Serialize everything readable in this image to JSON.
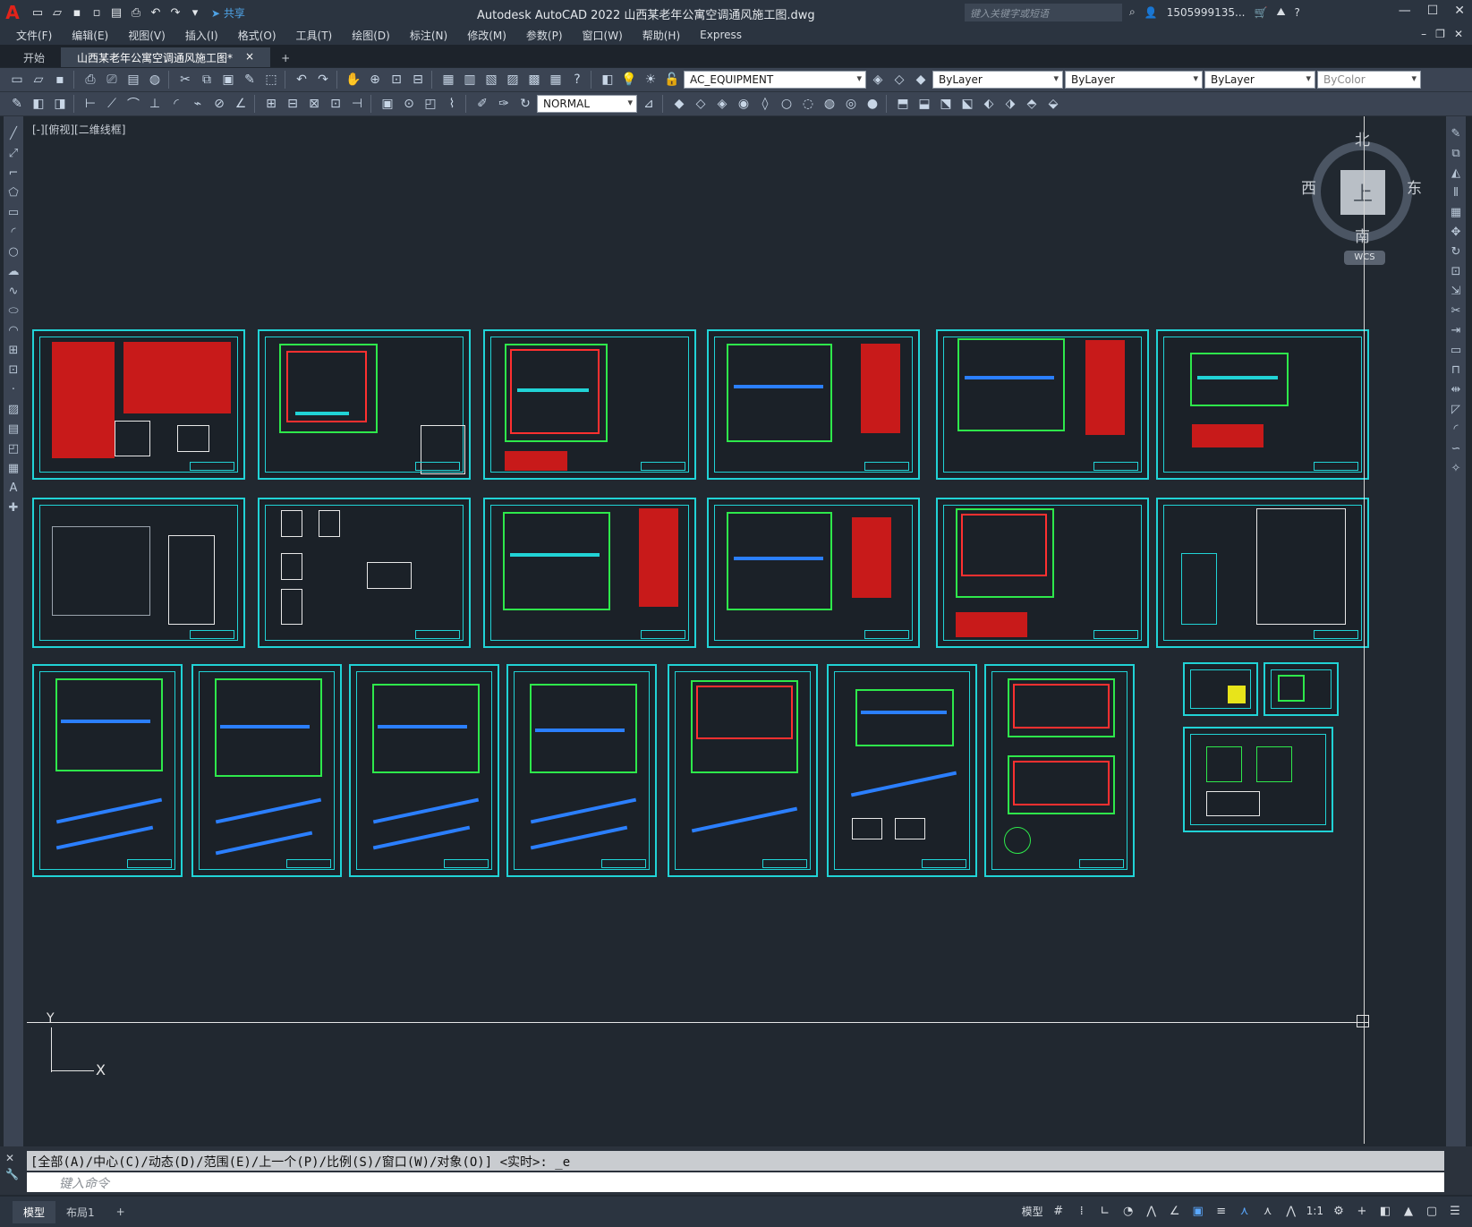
{
  "titlebar": {
    "app_logo": "A",
    "share_label": "共享",
    "title": "Autodesk AutoCAD 2022    山西某老年公寓空调通风施工图.dwg",
    "search_placeholder": "键入关键字或短语",
    "user": "1505999135..."
  },
  "menu": [
    "文件(F)",
    "编辑(E)",
    "视图(V)",
    "插入(I)",
    "格式(O)",
    "工具(T)",
    "绘图(D)",
    "标注(N)",
    "修改(M)",
    "参数(P)",
    "窗口(W)",
    "帮助(H)",
    "Express"
  ],
  "tabs": {
    "start": "开始",
    "active": "山西某老年公寓空调通风施工图*",
    "close": "×",
    "add": "+"
  },
  "toolbar1": {
    "layer": "AC_EQUIPMENT",
    "color": "ByLayer",
    "linetype": "ByLayer",
    "lineweight": "ByLayer",
    "plotstyle": "ByColor"
  },
  "toolbar2": {
    "visual_style": "NORMAL"
  },
  "canvas": {
    "viewport_label": "[-][俯视][二维线框]",
    "viewcube": {
      "north": "北",
      "south": "南",
      "east": "东",
      "west": "西",
      "face": "上",
      "wcs": "WCS"
    },
    "ucs": {
      "x": "X",
      "y": "Y"
    }
  },
  "command": {
    "history": "[全部(A)/中心(C)/动态(D)/范围(E)/上一个(P)/比例(S)/窗口(W)/对象(O)] <实时>: _e",
    "placeholder": "键入命令"
  },
  "status": {
    "model_tab": "模型",
    "layout_tab": "布局1",
    "add": "+",
    "model_label": "模型",
    "scale": "1:1"
  },
  "colors": {
    "sheet_border": "#21d3d6",
    "plan_green": "#2ee84b",
    "red_text": "#ff3030",
    "duct_blue": "#2b7fff"
  }
}
